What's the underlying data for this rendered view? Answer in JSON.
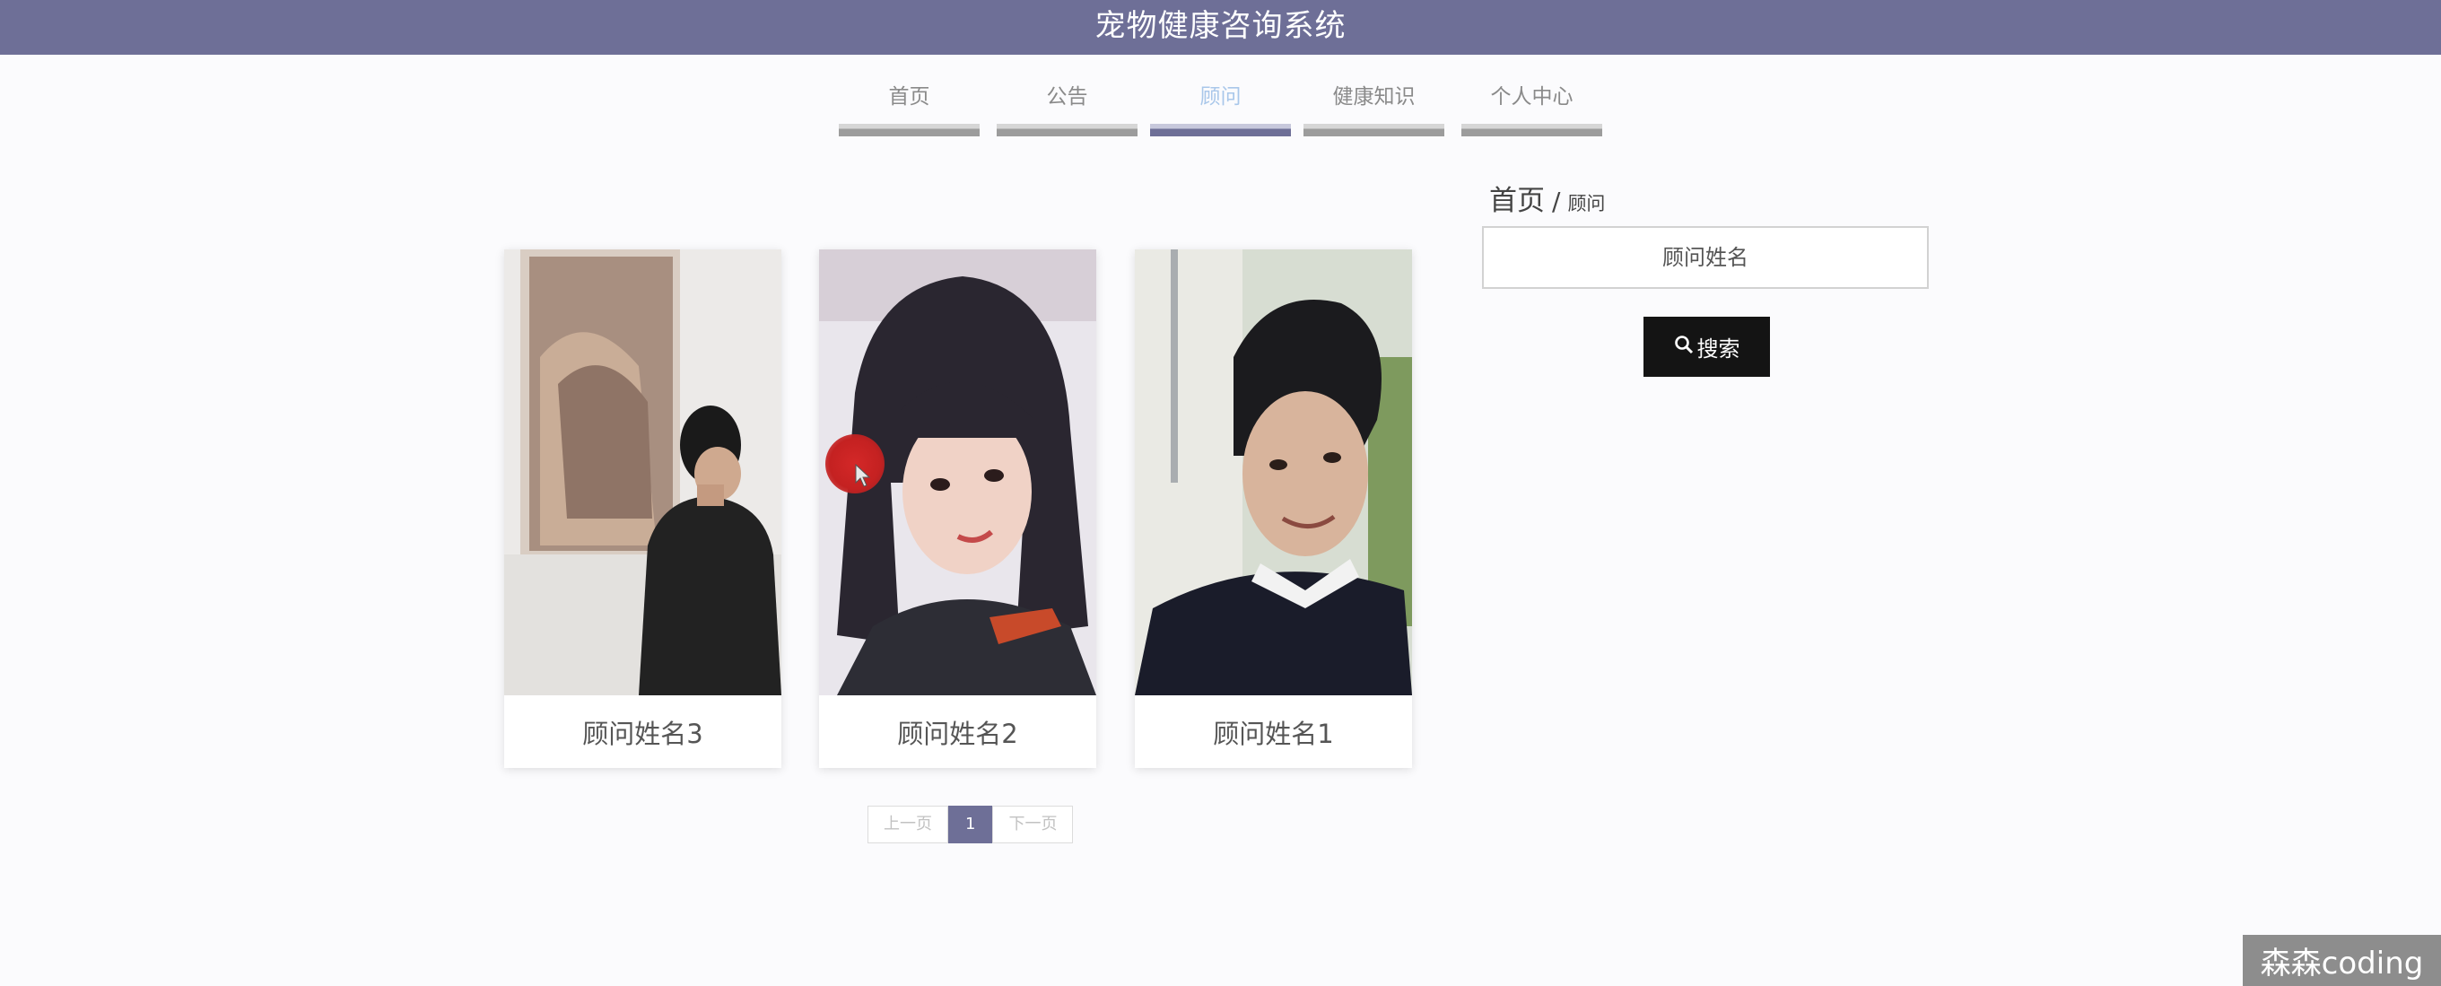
{
  "app": {
    "title": "宠物健康咨询系统"
  },
  "nav": {
    "items": [
      {
        "label": "首页",
        "active": false
      },
      {
        "label": "公告",
        "active": false
      },
      {
        "label": "顾问",
        "active": true
      },
      {
        "label": "健康知识",
        "active": false
      },
      {
        "label": "个人中心",
        "active": false
      }
    ]
  },
  "breadcrumb": {
    "home": "首页",
    "separator": "/",
    "current": "顾问"
  },
  "search": {
    "placeholder": "顾问姓名",
    "button_label": "搜索",
    "button_icon": "search-icon"
  },
  "cards": [
    {
      "name": "顾问姓名3",
      "photo": "consultant-photo-3"
    },
    {
      "name": "顾问姓名2",
      "photo": "consultant-photo-2"
    },
    {
      "name": "顾问姓名1",
      "photo": "consultant-photo-1"
    }
  ],
  "pagination": {
    "prev": "上一页",
    "current": "1",
    "next": "下一页"
  },
  "watermark": {
    "text": "森森coding"
  },
  "colors": {
    "header": "#6e6f97",
    "active_nav_text": "#a9c7ea",
    "search_button": "#141414"
  }
}
